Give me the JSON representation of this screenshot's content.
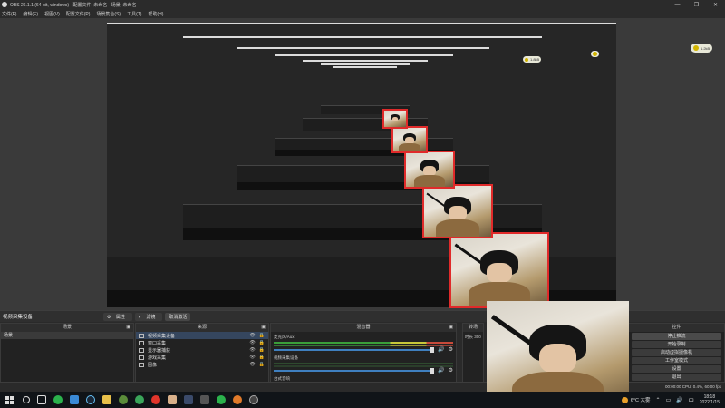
{
  "window": {
    "title": "OBS 26.1.1 (64-bit, windows) - 配置文件: 未命名 - 场景: 未命名",
    "buttons": [
      "—",
      "❐",
      "✕"
    ]
  },
  "menu": [
    "文件(F)",
    "编辑(E)",
    "视图(V)",
    "配置文件(P)",
    "场景集合(S)",
    "工具(T)",
    "帮助(H)"
  ],
  "float_badges": [
    {
      "text": "1.2kB"
    },
    {
      "text": "1.8kB"
    }
  ],
  "scene_label": {
    "current_source": "视频采集设备",
    "properties": "属性",
    "filters": "滤镜",
    "deactivate": "取消激活"
  },
  "scenes_dock": {
    "title": "场景",
    "items": [
      "场景"
    ]
  },
  "sources_dock": {
    "title": "来源",
    "items": [
      {
        "name": "视频采集设备",
        "selected": true
      },
      {
        "name": "窗口采集",
        "selected": false
      },
      {
        "name": "显示器捕获",
        "selected": false
      },
      {
        "name": "游戏采集",
        "selected": false
      },
      {
        "name": "图像",
        "selected": false
      }
    ]
  },
  "mixer_dock": {
    "title": "混音器",
    "channels": [
      {
        "name": "麦克风/Aux",
        "db": "0.0 dB"
      },
      {
        "name": "视频采集设备",
        "db": "0.0 dB"
      },
      {
        "name": "台式音响"
      }
    ]
  },
  "transition": {
    "title": "转场",
    "duration_label": "时长",
    "duration": "300"
  },
  "controls": {
    "title": "控件",
    "buttons": [
      "停止推流",
      "开始录制",
      "启动虚拟摄像机",
      "工作室模式",
      "设置",
      "退出"
    ]
  },
  "status": {
    "text": "00:00:00  CPU: 0.4%, 60.00 fps"
  },
  "taskbar": {
    "weather": "6°C 大雾",
    "time": "18:18",
    "date": "2022/1/15"
  },
  "colors": {
    "accent_red": "#e02a2a",
    "meter_green": "#3a9e3a",
    "meter_yellow": "#c8c83a",
    "volume_blue": "#3f7fbf"
  }
}
